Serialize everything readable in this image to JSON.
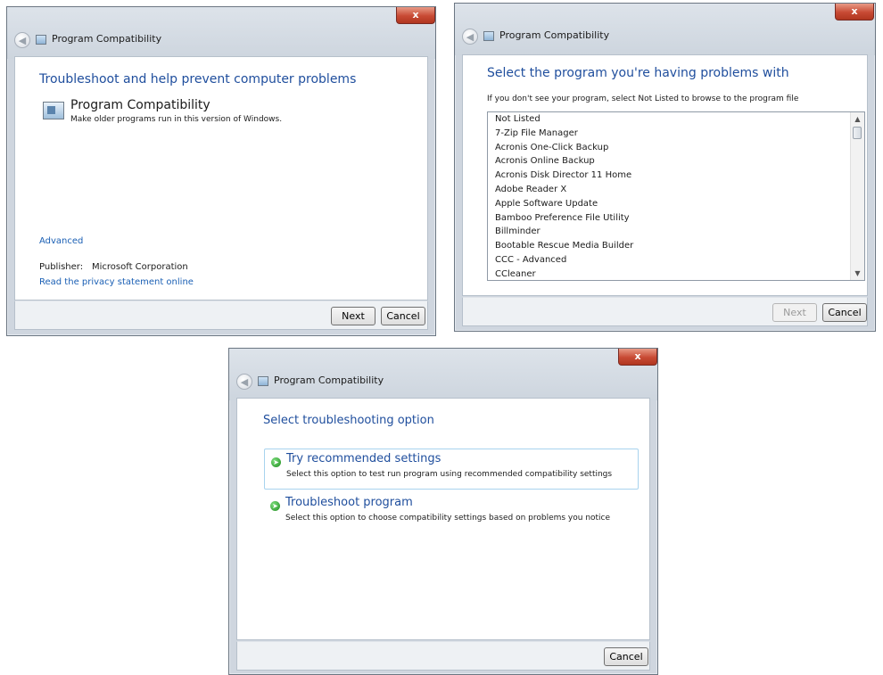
{
  "window_title": "Program Compatibility",
  "close_glyph": "x",
  "dialog1": {
    "heading": "Troubleshoot and help prevent computer problems",
    "item_title": "Program Compatibility",
    "item_desc": "Make older programs run in this version of Windows.",
    "advanced_link": "Advanced",
    "publisher_label": "Publisher:",
    "publisher_value": "Microsoft Corporation",
    "privacy_link": "Read the privacy statement online",
    "next_label": "Next",
    "cancel_label": "Cancel"
  },
  "dialog2": {
    "heading": "Select the program you're having problems with",
    "instruction": "If you don't see your program, select Not Listed to browse to the program file",
    "programs": [
      "Not Listed",
      "7-Zip File Manager",
      "Acronis One-Click Backup",
      "Acronis Online Backup",
      "Acronis Disk Director 11 Home",
      "Adobe Reader X",
      "Apple Software Update",
      "Bamboo Preference File Utility",
      "Billminder",
      "Bootable Rescue Media Builder",
      "CCC - Advanced",
      "CCleaner"
    ],
    "next_label": "Next",
    "cancel_label": "Cancel"
  },
  "dialog3": {
    "heading": "Select troubleshooting option",
    "options": [
      {
        "title": "Try recommended settings",
        "desc": "Select this option to test run program using recommended compatibility settings"
      },
      {
        "title": "Troubleshoot program",
        "desc": "Select this option to choose compatibility settings based on problems you notice"
      }
    ],
    "cancel_label": "Cancel"
  },
  "icons": {
    "back": "back-arrow-icon",
    "close": "close-icon",
    "option_arrow": "green-arrow-icon",
    "program": "program-compatibility-icon"
  },
  "colors": {
    "heading": "#1f4e9d",
    "link": "#1a5fb4",
    "close_button": "#c84a34",
    "option_border": "#a8d3ee"
  }
}
